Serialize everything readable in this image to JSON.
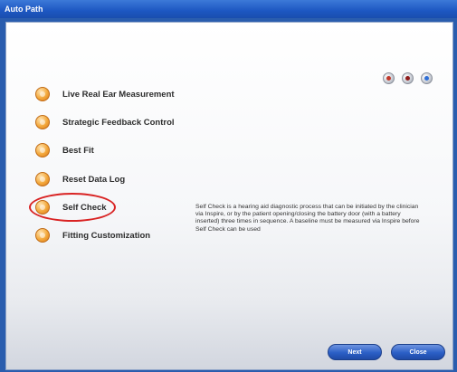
{
  "window": {
    "title": "Auto Path"
  },
  "top_icons": [
    {
      "icon": "settings-icon",
      "color": "#c0392b"
    },
    {
      "icon": "record-icon",
      "color": "#8e1b1b"
    },
    {
      "icon": "info-icon",
      "color": "#2f6fd6"
    }
  ],
  "menu": {
    "items": [
      {
        "label": "Live Real Ear Measurement"
      },
      {
        "label": "Strategic Feedback Control"
      },
      {
        "label": "Best Fit"
      },
      {
        "label": "Reset Data Log"
      },
      {
        "label": "Self Check",
        "highlighted": true
      },
      {
        "label": "Fitting Customization"
      }
    ]
  },
  "description": "Self Check is a hearing aid diagnostic process that can be initiated by the clinician via Inspire, or by the patient opening/closing the battery door (with a battery inserted) three times in sequence. A baseline must be measured via Inspire before Self Check can be used",
  "buttons": {
    "next": "Next",
    "close": "Close"
  },
  "colors": {
    "accent": "#2b5fc6",
    "highlight": "#d92323",
    "icon_orange": "#f3a83b"
  }
}
